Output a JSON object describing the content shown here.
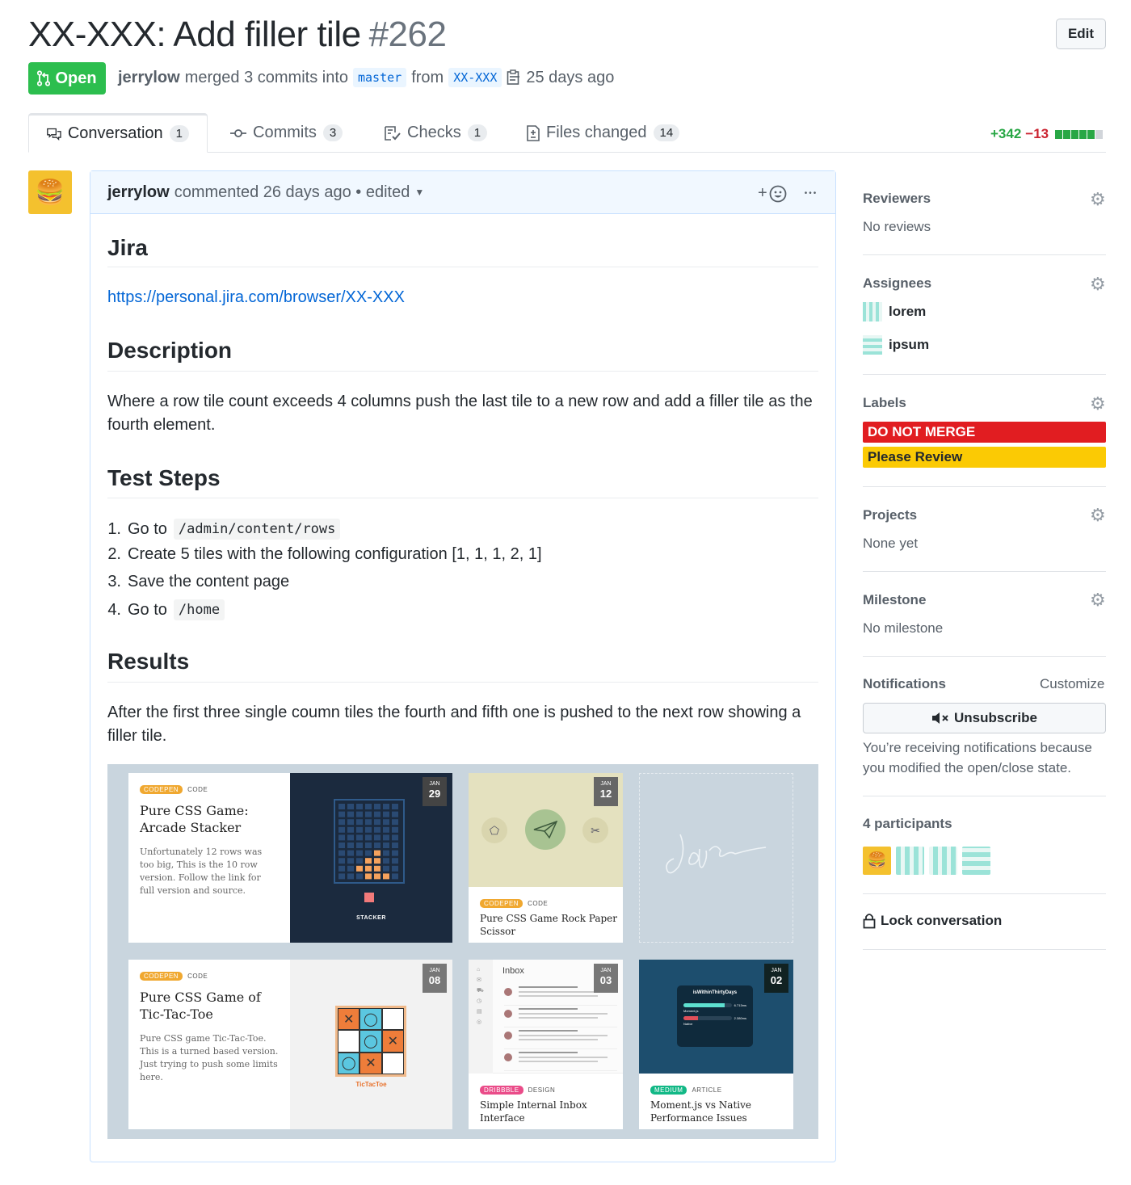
{
  "header": {
    "title": "XX-XXX: Add filler tile",
    "number": "#262",
    "edit_label": "Edit"
  },
  "state": {
    "label": "Open",
    "color": "#2cbe4e"
  },
  "meta": {
    "author": "jerrylow",
    "action": "merged 3 commits into",
    "base": "master",
    "from": "from",
    "head": "XX-XXX",
    "time": "25 days ago"
  },
  "tabs": [
    {
      "label": "Conversation",
      "count": "1"
    },
    {
      "label": "Commits",
      "count": "3"
    },
    {
      "label": "Checks",
      "count": "1"
    },
    {
      "label": "Files changed",
      "count": "14"
    }
  ],
  "diffstat": {
    "additions": "+342",
    "deletions": "−13",
    "segments": [
      "add",
      "add",
      "add",
      "add",
      "add",
      "neutral"
    ]
  },
  "comment": {
    "author": "jerrylow",
    "meta": "commented 26 days ago • edited",
    "reaction_icon": "+☺",
    "more": "•••",
    "jira_heading": "Jira",
    "jira_link": "https://personal.jira.com/browser/XX-XXX",
    "description_heading": "Description",
    "description": "Where a row tile count exceeds 4 columns push the last tile to a new row and add a filler tile as the fourth element.",
    "steps_heading": "Test Steps",
    "steps": [
      {
        "num": "1.",
        "text": "Go to",
        "code": "/admin/content/rows"
      },
      {
        "num": "2.",
        "text": "Create 5 tiles with the following configuration [1, 1, 1, 2, 1]",
        "code": ""
      },
      {
        "num": "3.",
        "text": "Save the content page",
        "code": ""
      },
      {
        "num": "4.",
        "text": "Go to",
        "code": "/home"
      }
    ],
    "results_heading": "Results",
    "results": "After the first three single coumn tiles the fourth and fifth one is pushed to the next row showing a filler tile."
  },
  "tiles": {
    "t1": {
      "source": "CODEPEN",
      "kind": "CODE",
      "title": "Pure CSS Game: Arcade Stacker",
      "desc": "Unfortunately 12 rows was too big, This is the 10 row version. Follow the link for full version and source.",
      "month": "JAN",
      "day": "29",
      "art_label": "STACKER"
    },
    "t2": {
      "source": "CODEPEN",
      "kind": "CODE",
      "title": "Pure CSS Game Rock Paper Scissor",
      "month": "JAN",
      "day": "12"
    },
    "t3": {
      "source": "CODEPEN",
      "kind": "CODE",
      "title": "Pure CSS Game of Tic-Tac-Toe",
      "desc": "Pure CSS game Tic-Tac-Toe. This is a turned based version. Just trying to push some limits here.",
      "month": "JAN",
      "day": "08",
      "art_label": "TicTacToe"
    },
    "t4": {
      "source": "DRIBBBLE",
      "kind": "DESIGN",
      "title": "Simple Internal Inbox Interface",
      "month": "JAN",
      "day": "03",
      "art_label": "Inbox"
    },
    "t5": {
      "source": "MEDIUM",
      "kind": "ARTICLE",
      "title": "Moment.js vs Native Performance Issues",
      "month": "JAN",
      "day": "02",
      "art_title": "isWithinThirtyDays",
      "art_rows": [
        "Moment.js",
        "Native"
      ],
      "art_values": [
        "6.713ms",
        "2.380ms"
      ],
      "art_shares": [
        0.85,
        0.3
      ]
    }
  },
  "sidebar": {
    "reviewers": {
      "heading": "Reviewers",
      "value": "No reviews"
    },
    "assignees": {
      "heading": "Assignees",
      "people": [
        "lorem",
        "ipsum"
      ]
    },
    "labels": {
      "heading": "Labels",
      "items": [
        {
          "name": "DO NOT MERGE",
          "color": "#e11d21"
        },
        {
          "name": "Please Review",
          "color": "#fbca04"
        }
      ]
    },
    "projects": {
      "heading": "Projects",
      "value": "None yet"
    },
    "milestone": {
      "heading": "Milestone",
      "value": "No milestone"
    },
    "notifications": {
      "heading": "Notifications",
      "customize": "Customize",
      "button": "Unsubscribe",
      "note": "You’re receiving notifications because you modified the open/close state."
    },
    "participants": {
      "heading": "4 participants"
    },
    "lock": "Lock conversation"
  },
  "colors": {
    "link": "#0366d6",
    "add": "#28a745",
    "del": "#cb2431",
    "codepen": "#f0a830",
    "dribbble": "#ea4c89",
    "medium": "#12b886"
  }
}
